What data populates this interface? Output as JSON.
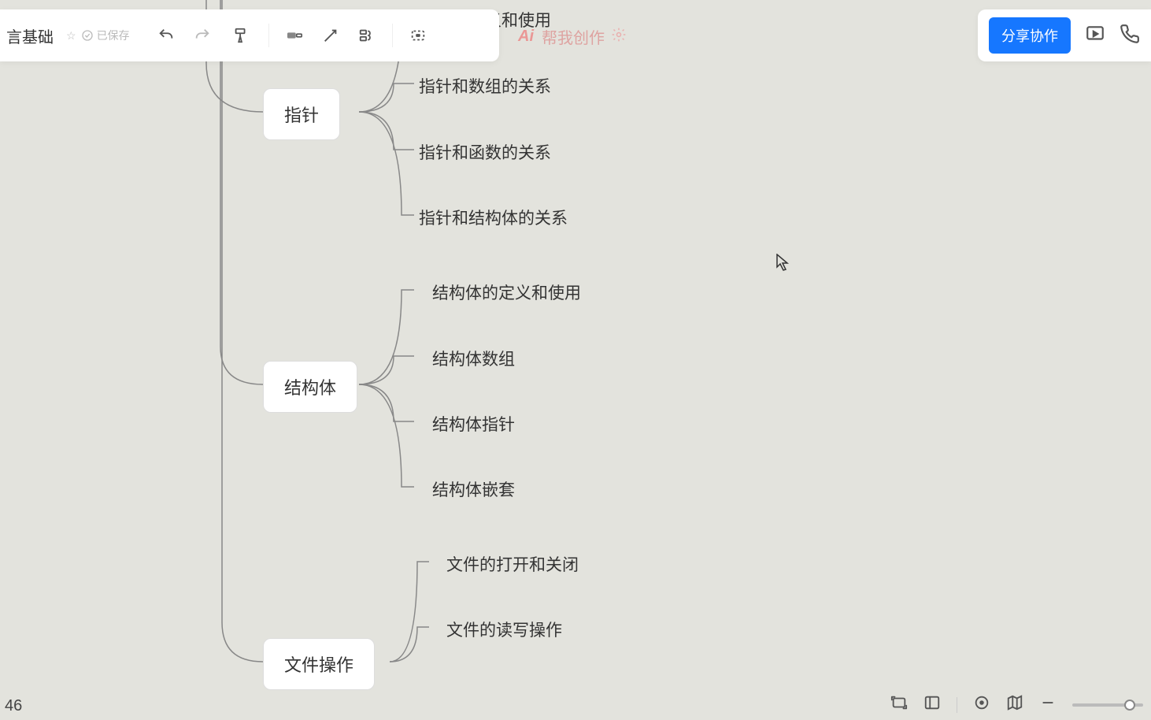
{
  "doc": {
    "title_fragment": "言基础",
    "saved_label": "已保存"
  },
  "ai": {
    "prefix": "Ai",
    "text": "帮我创作"
  },
  "share_label": "分享协作",
  "page_number": "46",
  "mindmap": {
    "n1": {
      "label": "指针",
      "children": [
        "指针的定义和使用",
        "指针和数组的关系",
        "指针和函数的关系",
        "指针和结构体的关系"
      ]
    },
    "n2": {
      "label": "结构体",
      "children": [
        "结构体的定义和使用",
        "结构体数组",
        "结构体指针",
        "结构体嵌套"
      ]
    },
    "n3": {
      "label": "文件操作",
      "children": [
        "文件的打开和关闭",
        "文件的读写操作"
      ]
    }
  }
}
